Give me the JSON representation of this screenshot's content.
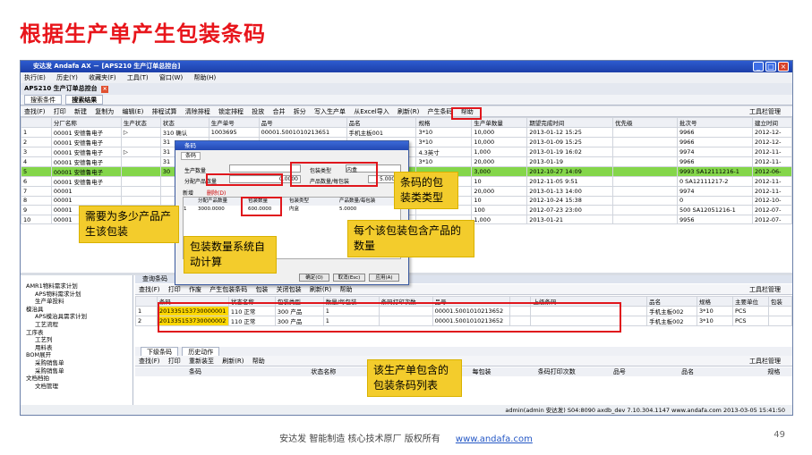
{
  "slide_title": "根据生产单产生包装条码",
  "window": {
    "title": "安达发 Andafa AX － [APS210 生产订单总控台]"
  },
  "menu": [
    "执行(E)",
    "历史(Y)",
    "收藏夹(F)",
    "工具(T)",
    "窗口(W)",
    "帮助(H)"
  ],
  "doc_tab": "APS210 生产订单总控台",
  "sub_tabs": [
    "搜索条件",
    "搜索结果"
  ],
  "toolbar1": [
    "查找(F)",
    "打印",
    "新建",
    "复制为",
    "编辑(E)",
    "排程试算",
    "清除排程",
    "锁定排程",
    "投放",
    "合并",
    "拆分",
    "写入生产单",
    "从Excel导入",
    "刷新(R)",
    "产生条码",
    "帮助"
  ],
  "toolbar_mgr": "工具栏管理",
  "grid1": {
    "headers": [
      "",
      "分厂名称",
      "生产状态",
      "状态",
      "生产单号",
      "品号",
      "品名",
      "规格",
      "生产单数量",
      "期望完成时间",
      "优先级",
      "批次号",
      "建立时间"
    ],
    "rows": [
      [
        "1",
        "00001 安德鲁电子",
        "▷",
        "310 确认",
        "1003695",
        "00001.5001010213651",
        "手机主板001",
        "3*10",
        "10,000",
        "2013-01-12 15:25",
        "",
        "9966",
        "2012-12-"
      ],
      [
        "2",
        "00001 安德鲁电子",
        "",
        "31",
        "",
        "",
        "",
        "3*10",
        "10,000",
        "2013-01-09 15:25",
        "",
        "9966",
        "2012-12-"
      ],
      [
        "3",
        "00001 安德鲁电子",
        "▷",
        "31",
        "",
        "",
        "",
        "4.3英寸",
        "1,000",
        "2013-01-19 16:02",
        "",
        "9974",
        "2012-11-"
      ],
      [
        "4",
        "00001 安德鲁电子",
        "",
        "31",
        "",
        "",
        "",
        "3*10",
        "20,000",
        "2013-01-19",
        "",
        "9966",
        "2012-11-"
      ],
      [
        "5",
        "00001 安德鲁电子",
        "",
        "30",
        "",
        "",
        "",
        "",
        "3,000",
        "2012-10-27 14:09",
        "",
        "9993 SA12111216-1",
        "2012-06-"
      ],
      [
        "6",
        "00001 安德鲁电子",
        "",
        "",
        "",
        "",
        "",
        "",
        "10",
        "2012-11-05 9:51",
        "",
        "0 SA12111217-2",
        "2012-11-"
      ],
      [
        "7",
        "00001",
        "",
        "",
        "",
        "",
        "",
        "",
        "20,000",
        "2013-01-13 14:00",
        "",
        "9974",
        "2012-11-"
      ],
      [
        "8",
        "00001",
        "",
        "",
        "",
        "",
        "",
        "",
        "10",
        "2012-10-24 15:38",
        "",
        "0",
        "2012-10-"
      ],
      [
        "9",
        "00001",
        "",
        "",
        "",
        "",
        "",
        "",
        "100",
        "2012-07-23 23:00",
        "",
        "500 SA12051216-1",
        "2012-07-"
      ],
      [
        "10",
        "00001",
        "",
        "",
        "",
        "",
        "",
        "",
        "1,000",
        "2013-01-21",
        "",
        "9956",
        "2012-07-"
      ]
    ]
  },
  "query_label": "查询条码",
  "toolbar2": [
    "查找(F)",
    "打印",
    "作废",
    "产生包装条码",
    "包装",
    "关闭包装",
    "刷新(R)",
    "帮助"
  ],
  "grid2": {
    "headers": [
      "",
      "条码",
      "状态名称",
      "包装类型",
      "数量/每包装",
      "条码打印次数",
      "品号",
      "",
      "上级条码",
      "品名",
      "规格",
      "主要单位",
      "包装"
    ],
    "rows": [
      [
        "1",
        "201335153730000001",
        "110 正常",
        "300 产品",
        "1",
        "",
        "00001.5001010213652",
        "",
        "",
        "手机主板002",
        "3*10",
        "PCS",
        ""
      ],
      [
        "2",
        "201335153730000002",
        "110 正常",
        "300 产品",
        "1",
        "",
        "00001.5001010213652",
        "",
        "",
        "手机主板002",
        "3*10",
        "PCS",
        ""
      ]
    ]
  },
  "lower_tabs": [
    "下级条码",
    "历史动作"
  ],
  "toolbar3": [
    "查找(F)",
    "打印",
    "重新装至",
    "刷新(R)",
    "帮助"
  ],
  "grid3_headers": [
    "条码",
    "状态名称",
    "",
    "每包装",
    "条码打印次数",
    "品号",
    "品名",
    "规格"
  ],
  "tree": [
    "AMR1物料需求计划",
    "APS物料需求计划",
    "生产单投料",
    "模治具",
    "APS模治具需求计划",
    "工艺流程",
    "工序表",
    "工艺列",
    "用料表",
    "BOM展开",
    "采购销售单",
    "采购销售单",
    "文档档拍",
    "文档管理"
  ],
  "status": "admin(admin 安达发)  S04:8090  axdb_dev  7.10.304.1147  www.andafa.com  2013-03-05 15:41:50",
  "dialog": {
    "title": "条码",
    "tab": "条码",
    "qty_label": "生产数量",
    "qty_value": "",
    "alloc_label": "分配产品数量",
    "alloc_value": "0.0000",
    "type_label": "包装类型",
    "type_value": "内盒",
    "per_label": "产品数量/每包装",
    "per_value": "5.0000",
    "new_btn": "新增",
    "del_btn": "删除(D)",
    "sub_headers": [
      "分配产品数量",
      "包装数量",
      "包装类型",
      "产品数量/每包装"
    ],
    "sub_row": [
      "1",
      "3000.0000",
      "600.0000",
      "内盒",
      "5.0000"
    ],
    "ok": "确定(O)",
    "cancel": "取消(Esc)",
    "apply": "应用(A)"
  },
  "callouts": {
    "c1": "需要为多少产品产生该包装",
    "c2": "包装数量系统自动计算",
    "c3": "条码的包装类类型",
    "c4": "每个该包装包含产品的数量",
    "c5": "该生产单包含的包装条码列表"
  },
  "footer": {
    "text": "安达发  智能制造 核心技术原厂  版权所有",
    "link": "www.andafa.com",
    "page": "49"
  }
}
